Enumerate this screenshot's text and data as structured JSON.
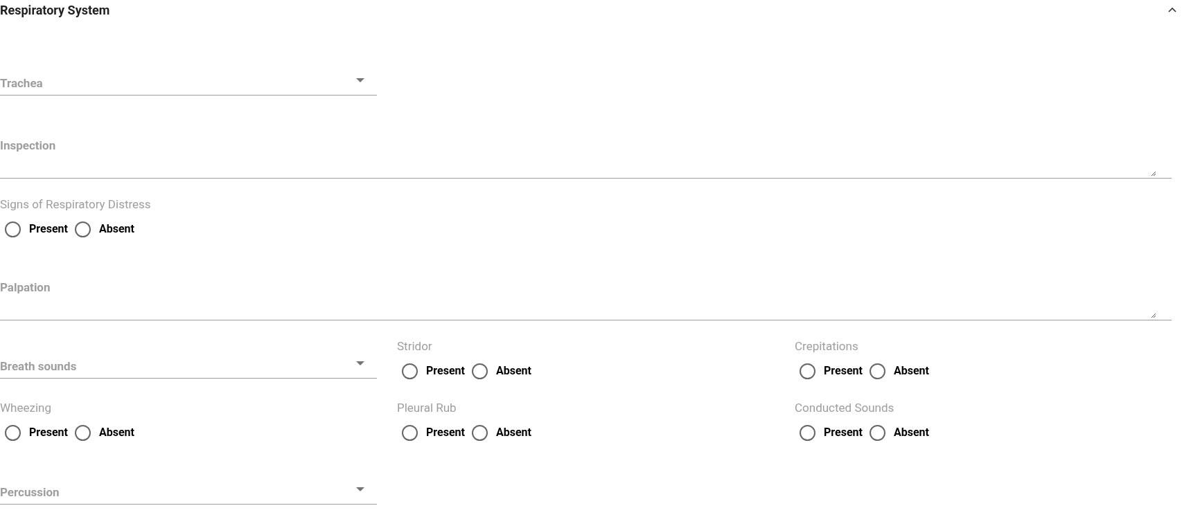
{
  "section": {
    "title": "Respiratory System",
    "expanded": true
  },
  "rows": [
    {
      "fields": [
        {
          "kind": "select",
          "label": "Trachea"
        }
      ]
    },
    {
      "fields": [
        {
          "kind": "textarea",
          "label": "Inspection"
        }
      ]
    },
    {
      "fields": [
        {
          "kind": "radio",
          "label": "Signs of Respiratory Distress",
          "options": [
            {
              "label": "Present",
              "selected": false
            },
            {
              "label": "Absent",
              "selected": false
            }
          ]
        }
      ]
    },
    {
      "fields": [
        {
          "kind": "textarea",
          "label": "Palpation"
        }
      ]
    },
    {
      "fields": [
        {
          "kind": "select",
          "label": "Breath sounds"
        },
        {
          "kind": "radio",
          "label": "Stridor",
          "options": [
            {
              "label": "Present",
              "selected": false
            },
            {
              "label": "Absent",
              "selected": false
            }
          ]
        },
        {
          "kind": "radio",
          "label": "Crepitations",
          "options": [
            {
              "label": "Present",
              "selected": false
            },
            {
              "label": "Absent",
              "selected": false
            }
          ]
        }
      ]
    },
    {
      "fields": [
        {
          "kind": "radio",
          "label": "Wheezing",
          "options": [
            {
              "label": "Present",
              "selected": false
            },
            {
              "label": "Absent",
              "selected": false
            }
          ]
        },
        {
          "kind": "radio",
          "label": "Pleural Rub",
          "options": [
            {
              "label": "Present",
              "selected": false
            },
            {
              "label": "Absent",
              "selected": false
            }
          ]
        },
        {
          "kind": "radio",
          "label": "Conducted Sounds",
          "options": [
            {
              "label": "Present",
              "selected": false
            },
            {
              "label": "Absent",
              "selected": false
            }
          ]
        }
      ]
    },
    {
      "fields": [
        {
          "kind": "select",
          "label": "Percussion"
        }
      ]
    }
  ]
}
